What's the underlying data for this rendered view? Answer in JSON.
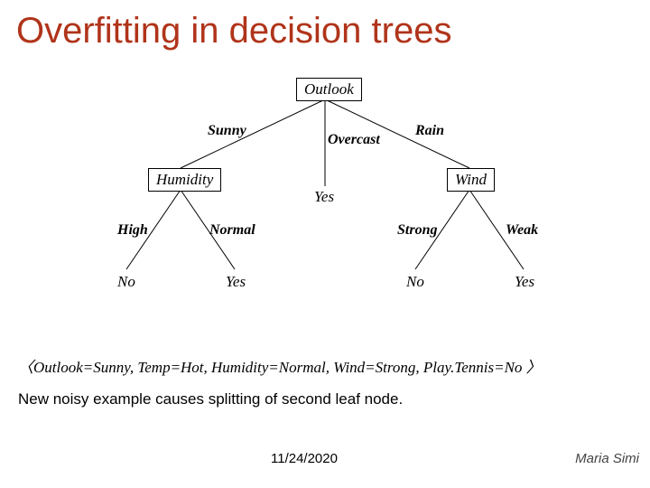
{
  "title": "Overfitting in decision trees",
  "tree": {
    "root": {
      "label": "Outlook"
    },
    "edges": {
      "sunny": "Sunny",
      "overcast": "Overcast",
      "rain": "Rain"
    },
    "left": {
      "node": "Humidity",
      "edges": {
        "high": "High",
        "normal": "Normal"
      },
      "leaves": {
        "high": "No",
        "normal": "Yes"
      }
    },
    "middle": {
      "leaf": "Yes"
    },
    "right": {
      "node": "Wind",
      "edges": {
        "strong": "Strong",
        "weak": "Weak"
      },
      "leaves": {
        "strong": "No",
        "weak": "Yes"
      }
    }
  },
  "example": "〈Outlook=Sunny, Temp=Hot, Humidity=Normal, Wind=Strong, Play.Tennis=No 〉",
  "caption": "New noisy example causes splitting of second leaf node.",
  "date": "11/24/2020",
  "author": "Maria Simi",
  "chart_data": {
    "type": "tree",
    "description": "Decision tree for PlayTennis classification",
    "root": {
      "attribute": "Outlook",
      "children": [
        {
          "edge": "Sunny",
          "attribute": "Humidity",
          "children": [
            {
              "edge": "High",
              "leaf": "No"
            },
            {
              "edge": "Normal",
              "leaf": "Yes"
            }
          ]
        },
        {
          "edge": "Overcast",
          "leaf": "Yes"
        },
        {
          "edge": "Rain",
          "attribute": "Wind",
          "children": [
            {
              "edge": "Strong",
              "leaf": "No"
            },
            {
              "edge": "Weak",
              "leaf": "Yes"
            }
          ]
        }
      ]
    }
  }
}
